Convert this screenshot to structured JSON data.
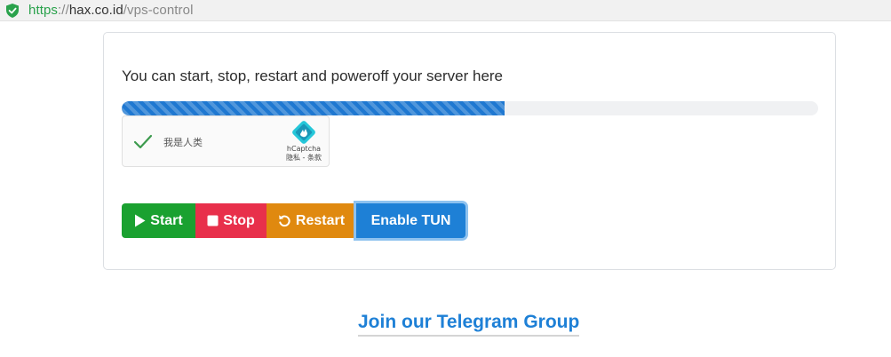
{
  "address_bar": {
    "protocol": "https",
    "separator": "://",
    "host": "hax.co.id",
    "path": "/vps-control",
    "secure_color": "#2aa24c"
  },
  "card": {
    "intro_text": "You can start, stop, restart and poweroff your server here",
    "progress_fraction": 0.55,
    "progress_color": "#1f78d1"
  },
  "captcha": {
    "label": "我是人类",
    "brand": "hCaptcha",
    "links": "隐私 - 条款",
    "check_icon": "check-icon",
    "logo_icon": "hcaptcha-logo-icon"
  },
  "buttons": {
    "start": {
      "label": "Start",
      "icon": "play-icon",
      "color": "#1aa130"
    },
    "stop": {
      "label": "Stop",
      "icon": "stop-icon",
      "color": "#e8304b"
    },
    "restart": {
      "label": "Restart",
      "icon": "restart-icon",
      "color": "#e0890f"
    },
    "tun": {
      "label": "Enable TUN",
      "color": "#1e80d6"
    }
  },
  "footer": {
    "telegram_link": "Join our Telegram Group",
    "link_color": "#1e80d6"
  }
}
